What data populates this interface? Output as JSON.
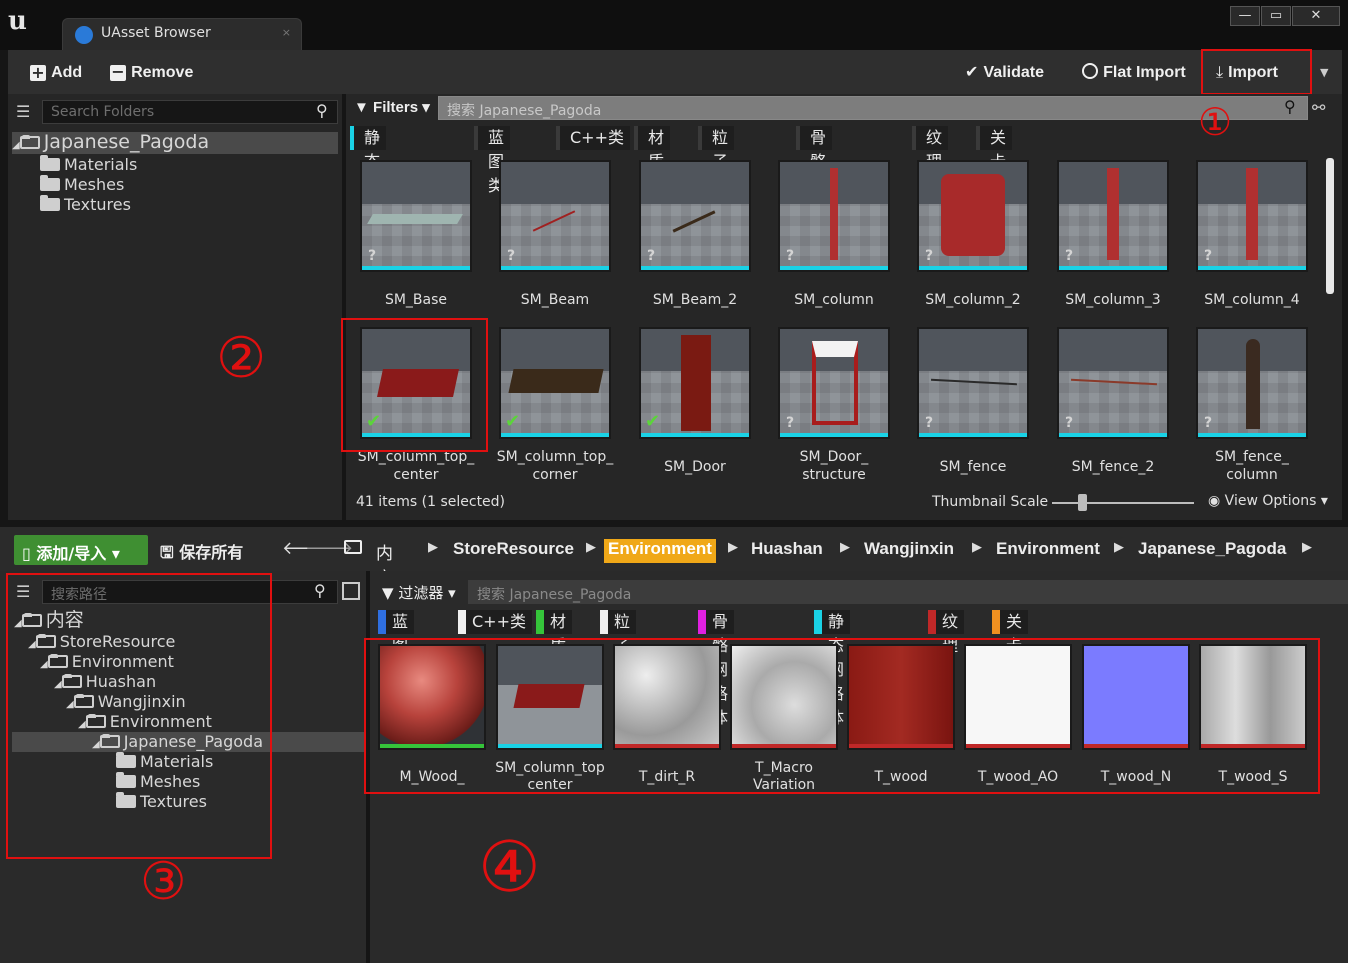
{
  "window": {
    "tab_title": "UAsset Browser",
    "min": "—",
    "max": "▭",
    "close": "✕",
    "logo": "u"
  },
  "toolbar": {
    "add": "Add",
    "remove": "Remove",
    "validate": "Validate",
    "flat_import": "Flat Import",
    "import": "Import"
  },
  "top_tree": {
    "search_placeholder": "Search Folders",
    "root": "Japanese_Pagoda",
    "children": [
      "Materials",
      "Meshes",
      "Textures"
    ]
  },
  "top_filter": {
    "filters_label": "Filters",
    "search_placeholder": "搜索 Japanese_Pagoda",
    "chips": [
      {
        "label": "静态网格体",
        "color": "#1ad2e6"
      },
      {
        "label": "蓝图类",
        "color": "#3a3a3a"
      },
      {
        "label": "C++类",
        "color": "#3a3a3a"
      },
      {
        "label": "材质",
        "color": "#3a3a3a"
      },
      {
        "label": "粒子系统",
        "color": "#3a3a3a"
      },
      {
        "label": "骨骼网格体",
        "color": "#3a3a3a"
      },
      {
        "label": "纹理",
        "color": "#3a3a3a"
      },
      {
        "label": "关卡",
        "color": "#3a3a3a"
      }
    ]
  },
  "top_assets": [
    {
      "name": "SM_Base",
      "status": "?"
    },
    {
      "name": "SM_Beam",
      "status": "?"
    },
    {
      "name": "SM_Beam_2",
      "status": "?"
    },
    {
      "name": "SM_column",
      "status": "?"
    },
    {
      "name": "SM_column_2",
      "status": "?"
    },
    {
      "name": "SM_column_3",
      "status": "?"
    },
    {
      "name": "SM_column_4",
      "status": "?"
    },
    {
      "name": "SM_column_top_\ncenter",
      "status": "✔"
    },
    {
      "name": "SM_column_top_\ncorner",
      "status": "✔"
    },
    {
      "name": "SM_Door",
      "status": "✔"
    },
    {
      "name": "SM_Door_\nstructure",
      "status": "?"
    },
    {
      "name": "SM_fence",
      "status": "?"
    },
    {
      "name": "SM_fence_2",
      "status": "?"
    },
    {
      "name": "SM_fence_\ncolumn",
      "status": "?"
    }
  ],
  "top_status": {
    "items": "41 items (1 selected)",
    "thumb_scale": "Thumbnail Scale",
    "view_options": "View Options"
  },
  "bottom_toolbar": {
    "add_import": "添加/导入",
    "save_all": "保存所有"
  },
  "breadcrumb": [
    "内容",
    "StoreResource",
    "Environment",
    "Huashan",
    "Wangjinxin",
    "Environment",
    "Japanese_Pagoda"
  ],
  "bottom_tree": {
    "search_placeholder": "搜索路径",
    "nodes": [
      "内容",
      "StoreResource",
      "Environment",
      "Huashan",
      "Wangjinxin",
      "Environment",
      "Japanese_Pagoda",
      "Materials",
      "Meshes",
      "Textures"
    ]
  },
  "bottom_filter": {
    "filters_label": "过滤器",
    "search_placeholder": "搜索 Japanese_Pagoda",
    "chips": [
      {
        "label": "蓝图类",
        "color": "#2f6fe0"
      },
      {
        "label": "C++类",
        "color": "#f0f0f0"
      },
      {
        "label": "材质",
        "color": "#35c43a"
      },
      {
        "label": "粒子系统",
        "color": "#f0f0f0"
      },
      {
        "label": "骨骼网格体",
        "color": "#e020e0"
      },
      {
        "label": "静态网格体",
        "color": "#1ad2e6"
      },
      {
        "label": "纹理",
        "color": "#c02828"
      },
      {
        "label": "关卡",
        "color": "#f09020"
      }
    ]
  },
  "bottom_assets": [
    {
      "name": "M_Wood_"
    },
    {
      "name": "SM_column_top\ncenter"
    },
    {
      "name": "T_dirt_R"
    },
    {
      "name": "T_Macro\nVariation"
    },
    {
      "name": "T_wood"
    },
    {
      "name": "T_wood_AO"
    },
    {
      "name": "T_wood_N"
    },
    {
      "name": "T_wood_S"
    }
  ],
  "annotations": [
    "①",
    "②",
    "③",
    "④"
  ]
}
